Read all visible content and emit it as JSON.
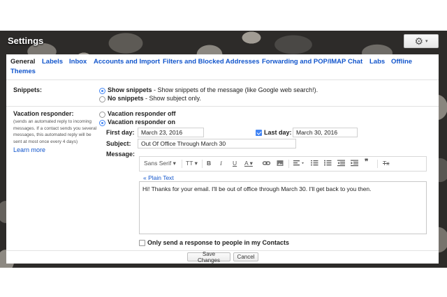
{
  "header": {
    "title": "Settings",
    "gear_icon": "gear-icon",
    "caret": "▾"
  },
  "tabs": [
    {
      "label": "General",
      "active": true
    },
    {
      "label": "Labels"
    },
    {
      "label": "Inbox"
    },
    {
      "label": "Accounts and Import"
    },
    {
      "label": "Filters and Blocked Addresses"
    },
    {
      "label": "Forwarding and POP/IMAP"
    },
    {
      "label": "Chat"
    },
    {
      "label": "Labs"
    },
    {
      "label": "Offline"
    },
    {
      "label": "Themes"
    }
  ],
  "snippets": {
    "label": "Snippets:",
    "show_title": "Show snippets",
    "show_desc": " - Show snippets of the message (like Google web search!).",
    "no_title": "No snippets",
    "no_desc": " - Show subject only."
  },
  "vacation": {
    "label": "Vacation responder:",
    "help": "(sends an automated reply to incoming messages. If a contact sends you several messages, this automated reply will be sent at most once every 4 days)",
    "learn_more": "Learn more",
    "off_label": "Vacation responder off",
    "on_label": "Vacation responder on",
    "first_day_label": "First day:",
    "first_day_value": "March 23, 2016",
    "last_day_label": "Last day:",
    "last_day_value": "March 30, 2016",
    "subject_label": "Subject:",
    "subject_value": "Out Of Office Through March 30",
    "message_label": "Message:",
    "plain_text_link": "« Plain Text",
    "message_body": "Hi! Thanks for your email. I'll be out of office through March 30. I'll get back to you then.",
    "contacts_only_label": "Only send a response to people in my Contacts"
  },
  "toolbar": {
    "font": "Sans Serif",
    "size": "TT",
    "bold": "B",
    "italic": "I",
    "underline": "U",
    "color": "A",
    "link_icon": "link-icon",
    "image_icon": "image-icon",
    "align_icon": "align-icon",
    "numbered_icon": "numbered-list-icon",
    "bullet_icon": "bulleted-list-icon",
    "indent_less_icon": "indent-less-icon",
    "indent_more_icon": "indent-more-icon",
    "quote": "❞",
    "clear": "Tx",
    "caret": "▾"
  },
  "actions": {
    "save": "Save Changes",
    "cancel": "Cancel"
  },
  "colors": {
    "link": "#1155cc",
    "radio_selected": "#4285f4"
  }
}
